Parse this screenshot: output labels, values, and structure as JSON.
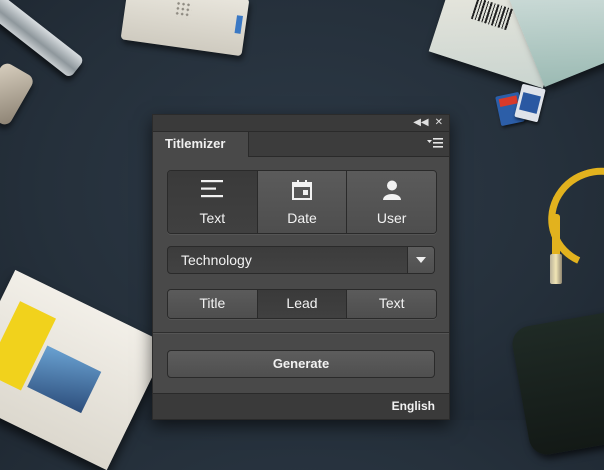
{
  "panel": {
    "tab_title": "Titlemizer",
    "source_options": [
      {
        "label": "Text",
        "icon": "lines-icon",
        "active": true
      },
      {
        "label": "Date",
        "icon": "calendar-icon",
        "active": false
      },
      {
        "label": "User",
        "icon": "user-icon",
        "active": false
      }
    ],
    "category": {
      "selected": "Technology"
    },
    "fields": [
      {
        "label": "Title",
        "active": false
      },
      {
        "label": "Lead",
        "active": true
      },
      {
        "label": "Text",
        "active": false
      }
    ],
    "generate_label": "Generate",
    "language": "English"
  },
  "colors": {
    "panel_bg": "#494949",
    "active_bg": "#3c3c3c",
    "text": "#f2f2f2"
  }
}
